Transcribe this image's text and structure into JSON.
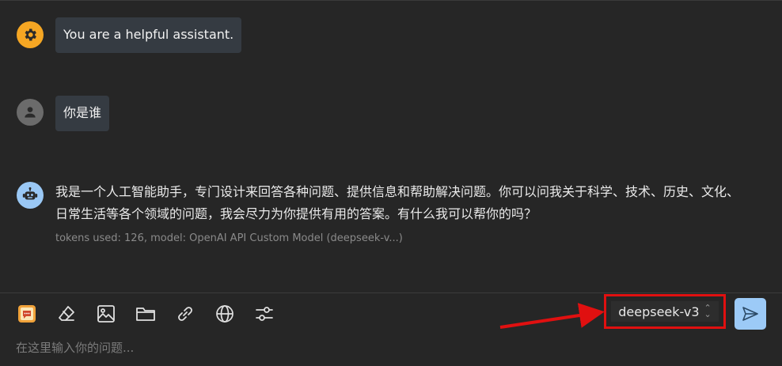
{
  "messages": {
    "system": {
      "role_icon": "gear-icon",
      "text": "You are a helpful assistant."
    },
    "user": {
      "role_icon": "user-icon",
      "text": "你是谁"
    },
    "assistant": {
      "role_icon": "robot-icon",
      "text": "我是一个人工智能助手，专门设计来回答各种问题、提供信息和帮助解决问题。你可以问我关于科学、技术、历史、文化、日常生活等各个领域的问题，我会尽力为你提供有用的答案。有什么我可以帮你的吗？",
      "meta": "tokens used: 126, model: OpenAI API Custom Model (deepseek-v...)"
    }
  },
  "toolbar": {
    "items": [
      {
        "icon": "chat-prompt-icon"
      },
      {
        "icon": "eraser-icon"
      },
      {
        "icon": "image-icon"
      },
      {
        "icon": "folder-icon"
      },
      {
        "icon": "link-icon"
      },
      {
        "icon": "globe-icon"
      },
      {
        "icon": "settings-sliders-icon"
      }
    ]
  },
  "model_selector": {
    "value": "deepseek-v3"
  },
  "composer": {
    "placeholder": "在这里输入你的问题..."
  },
  "colors": {
    "background": "#262626",
    "system_avatar": "#f5a623",
    "user_avatar": "#6b6b6b",
    "bot_avatar": "#9ac8f5",
    "send_button": "#9ccaf7",
    "annotation_red": "#e01010"
  }
}
